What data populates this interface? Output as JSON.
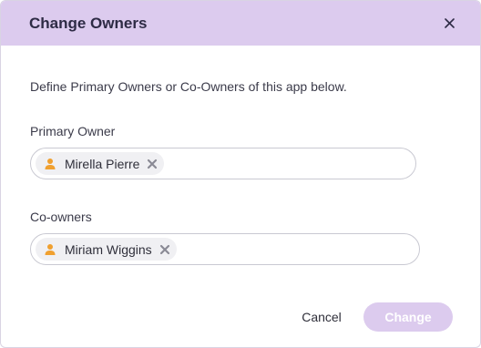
{
  "dialog": {
    "title": "Change Owners",
    "close_icon": "close-icon",
    "description": "Define Primary Owners or Co-Owners of this app below."
  },
  "primary_owner": {
    "label": "Primary Owner",
    "chips": [
      {
        "name": "Mirella Pierre"
      }
    ]
  },
  "co_owners": {
    "label": "Co-owners",
    "chips": [
      {
        "name": "Miriam Wiggins"
      }
    ]
  },
  "footer": {
    "cancel_label": "Cancel",
    "change_label": "Change"
  },
  "colors": {
    "header_bg": "#dccbee",
    "person_icon": "#f0a030",
    "change_button_bg": "#dccbee"
  }
}
